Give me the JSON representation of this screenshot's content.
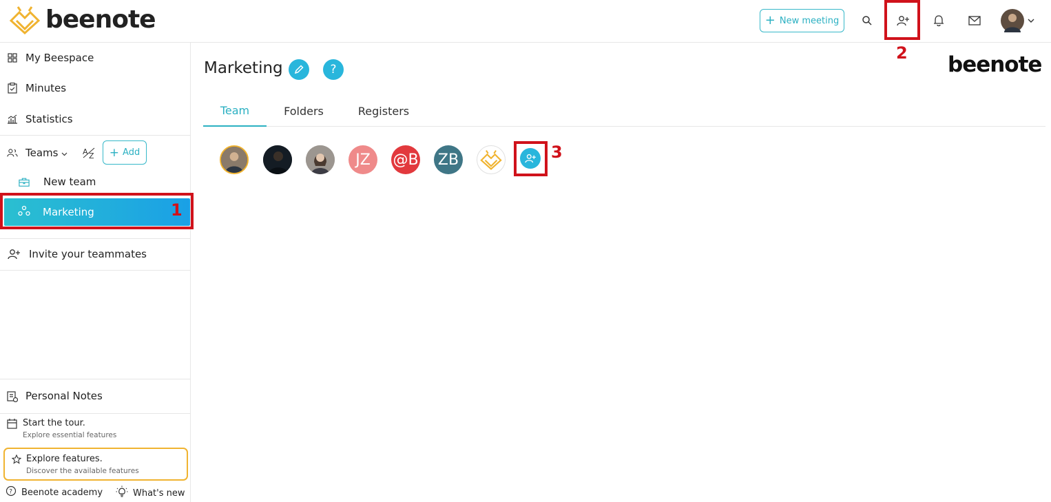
{
  "topbar": {
    "logo_text": "beenote",
    "new_meeting_label": "New meeting",
    "icons": [
      "search-icon",
      "add-user-icon",
      "bell-icon",
      "mail-icon",
      "avatar",
      "chevron-down-icon"
    ]
  },
  "annotations": {
    "marker_1": "1",
    "marker_2": "2",
    "marker_3": "3"
  },
  "sidebar": {
    "items": [
      {
        "label": "My Beespace",
        "icon": "grid-icon"
      },
      {
        "label": "Minutes",
        "icon": "clipboard-icon"
      },
      {
        "label": "Statistics",
        "icon": "chart-icon"
      }
    ],
    "teams_label": "Teams",
    "sort_label": "A/Z",
    "add_label": "Add",
    "teams": [
      {
        "label": "New team",
        "icon": "briefcase-icon"
      },
      {
        "label": "Marketing",
        "icon": "team-icon",
        "active": true
      }
    ],
    "invite_label": "Invite your teammates",
    "personal_notes_label": "Personal Notes",
    "tour": {
      "title": "Start the tour.",
      "subtitle": "Explore essential features"
    },
    "explore": {
      "title": "Explore features.",
      "subtitle": "Discover the available features"
    },
    "academy_label": "Beenote academy",
    "whats_new_label": "What's new"
  },
  "main": {
    "title": "Marketing",
    "help_glyph": "?",
    "brand": "beenote",
    "tabs": [
      {
        "label": "Team",
        "active": true
      },
      {
        "label": "Folders",
        "active": false
      },
      {
        "label": "Registers",
        "active": false
      }
    ],
    "members": [
      {
        "initials": "",
        "color": "#6b5a4a",
        "kind": "photo"
      },
      {
        "initials": "",
        "color": "#1c2530",
        "kind": "photo"
      },
      {
        "initials": "",
        "color": "#8a8580",
        "kind": "photo"
      },
      {
        "initials": "JZ",
        "color": "#ef8a8a",
        "kind": "initials"
      },
      {
        "initials": "@B",
        "color": "#e2393d",
        "kind": "initials"
      },
      {
        "initials": "ZB",
        "color": "#3f7686",
        "kind": "initials"
      },
      {
        "initials": "",
        "color": "#ffffff",
        "kind": "logo"
      }
    ]
  },
  "colors": {
    "accent": "#2bb0c2",
    "highlight": "#d0121b",
    "explore_border": "#f0b330"
  }
}
